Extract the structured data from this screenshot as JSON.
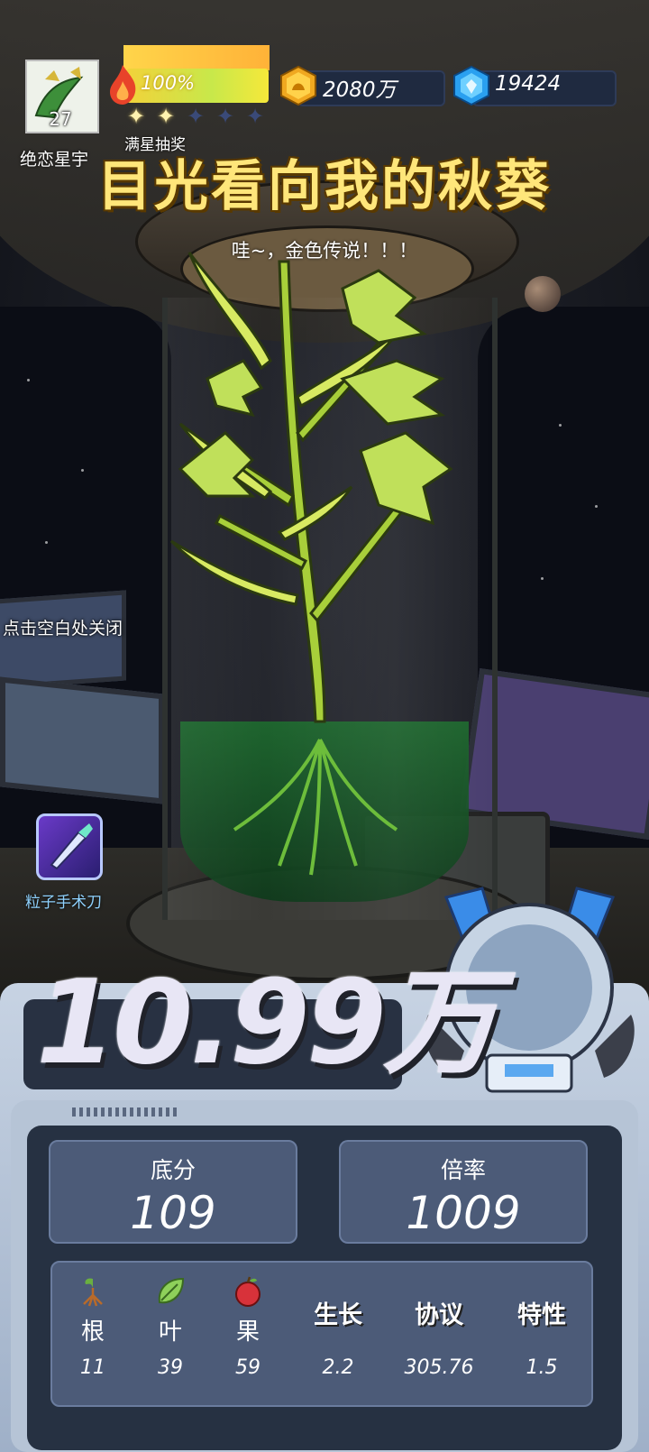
{
  "player": {
    "name": "绝恋星宇",
    "level": "27",
    "avatar_icon": "dragon-avatar-icon"
  },
  "energy": {
    "percent_label": "100%",
    "level": 1.0,
    "stars_filled": 2,
    "stars_total": 5,
    "star_label": "满星抽奖"
  },
  "resources": {
    "coins": "2080万",
    "gems": "19424"
  },
  "reveal": {
    "title": "目光看向我的秋葵",
    "subtitle": "哇~，金色传说！！！",
    "close_hint": "点击空白处关闭"
  },
  "tool": {
    "label": "粒子手术刀",
    "icon": "scalpel-icon"
  },
  "score": {
    "total": "10.99万",
    "base_label": "底分",
    "base_value": "109",
    "multiplier_label": "倍率",
    "multiplier_value": "1009"
  },
  "attributes": [
    {
      "name": "根",
      "value": "11",
      "icon": "root-icon"
    },
    {
      "name": "叶",
      "value": "39",
      "icon": "leaf-icon"
    },
    {
      "name": "果",
      "value": "59",
      "icon": "apple-icon"
    },
    {
      "name": "生长",
      "value": "2.2"
    },
    {
      "name": "协议",
      "value": "305.76"
    },
    {
      "name": "特性",
      "value": "1.5"
    }
  ],
  "colors": {
    "title_gold": "#ffe67a",
    "panel_dark": "#263142",
    "card_blue": "#4c5b78",
    "plant_green": "#a8cf3a"
  }
}
